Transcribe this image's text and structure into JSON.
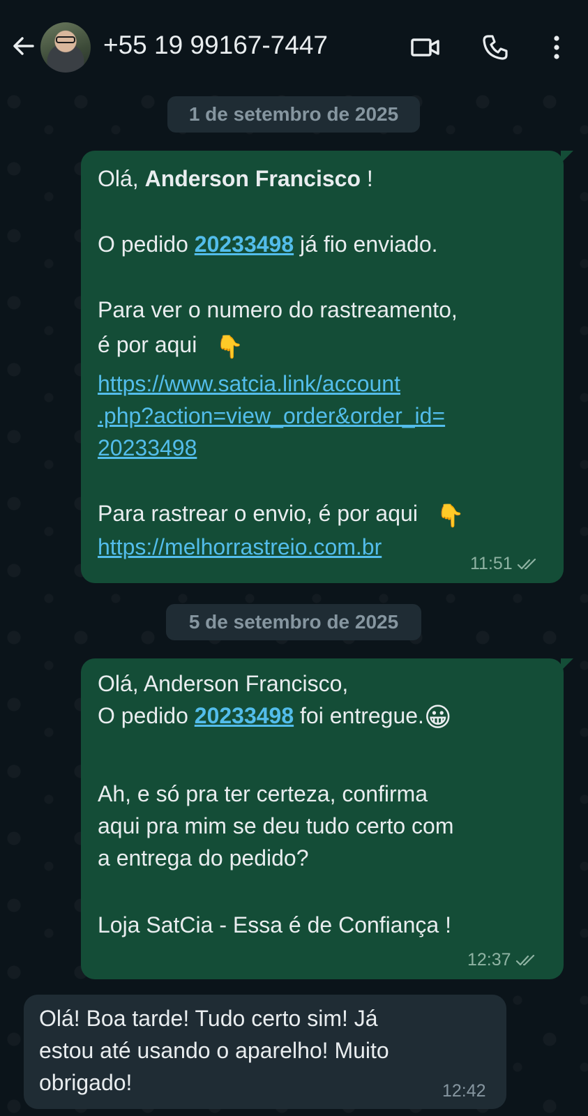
{
  "header": {
    "contact_name": "+55 19 99167-7447",
    "icons": [
      "back-arrow-icon",
      "video-call-icon",
      "phone-icon",
      "more-options-icon"
    ]
  },
  "colors": {
    "outgoing_bubble": "#144d37",
    "incoming_bubble": "#1f2c34",
    "link": "#53bdeb",
    "background": "#0b141a"
  },
  "date_chips": [
    "1 de setembro de 2025",
    "5 de setembro de 2025"
  ],
  "messages": [
    {
      "direction": "outgoing",
      "greeting_prefix": "Olá, ",
      "greeting_name": "Anderson Francisco",
      "greeting_suffix": " !",
      "order_prefix": "O pedido ",
      "order_number": "20233498",
      "order_suffix": " já fio enviado.",
      "tracking_line1": "Para ver o numero do rastreamento,",
      "tracking_line2": "é por aqui",
      "tracking_emoji": "👇",
      "link1_line1": "https://www.satcia.link/account",
      "link1_line2": ".php?action=view_order&order_id=",
      "link1_line3": "20233498",
      "shipment_line": "Para rastrear o envio, é por aqui",
      "shipment_emoji": "👇",
      "link2": "https://melhorrastreio.com.br",
      "time": "11:51",
      "status": "read"
    },
    {
      "direction": "outgoing",
      "line1": "Olá, Anderson Francisco,",
      "order_prefix": "O pedido ",
      "order_number": "20233498",
      "order_suffix": " foi entregue.",
      "emoji": "😀",
      "line3": "Ah, e só pra ter certeza, confirma",
      "line4": "aqui pra mim se deu tudo certo com",
      "line5": "a entrega do pedido?",
      "line6": "Loja SatCia - Essa é de Confiança !",
      "time": "12:37",
      "status": "read"
    },
    {
      "direction": "incoming",
      "line1": "Olá! Boa tarde! Tudo certo sim! Já",
      "line2": "estou até usando o aparelho! Muito",
      "line3": "obrigado!",
      "time": "12:42"
    }
  ]
}
